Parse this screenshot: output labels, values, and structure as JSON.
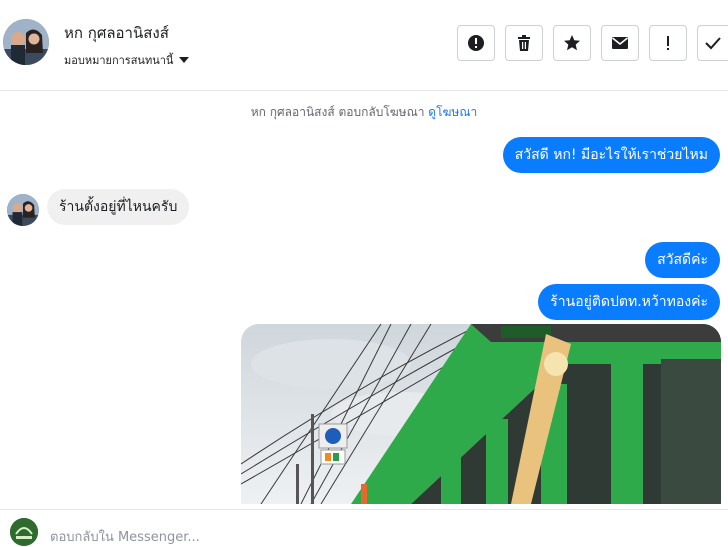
{
  "header": {
    "contact_name": "หก กุศลอานิสงส์",
    "assign_label": "มอบหมายการสนทนานี้",
    "toolbar": [
      "spam-icon",
      "trash-icon",
      "star-icon",
      "mail-icon",
      "important-icon",
      "check-icon"
    ]
  },
  "meta": {
    "reply_text": "หก กุศลอานิสงส์ ตอบกลับโฆษณา",
    "view_ad_link": "ดูโฆษณา"
  },
  "messages": {
    "out_1": "สวัสดี หก! มีอะไรให้เราช่วยไหม",
    "in_1": "ร้านตั้งอยู่ที่ไหนครับ",
    "out_2": "สวัสดีค่ะ",
    "out_3": "ร้านอยู่ติดปตท.หว้าทองค่ะ"
  },
  "composer": {
    "placeholder": "ตอบกลับใน Messenger..."
  },
  "colors": {
    "accent": "#0a7cff",
    "link": "#1877f2",
    "incoming_bubble": "#f0f0f0",
    "storefront_green": "#2faa4a"
  }
}
